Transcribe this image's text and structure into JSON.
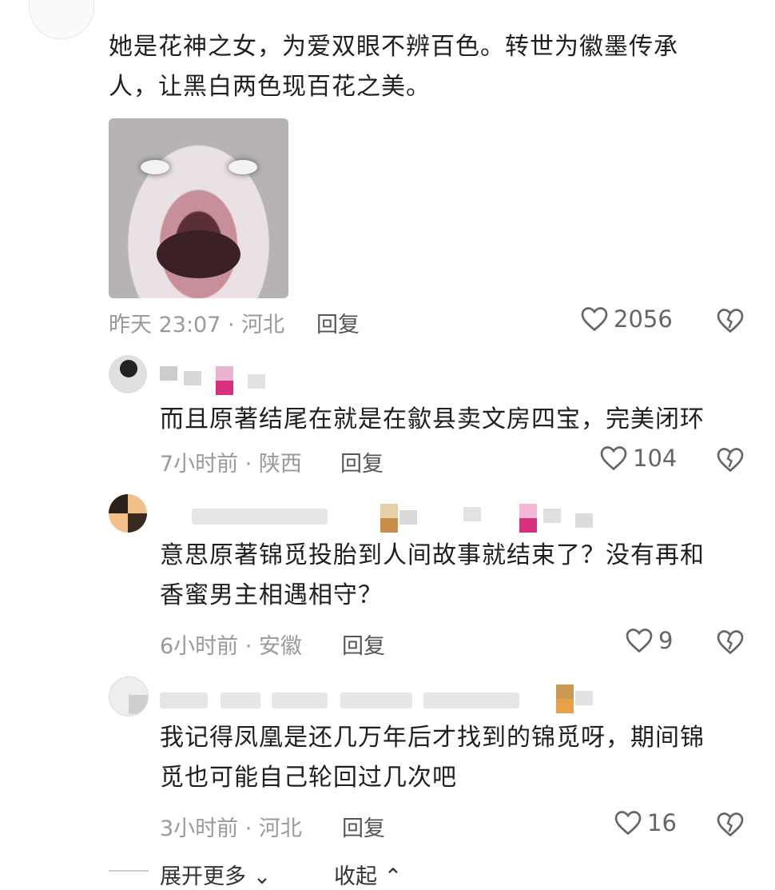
{
  "top_comment": {
    "text_line1": "她是花神之女，为爱双眼不辨百色。转世为徽墨传承",
    "text_line2": "人，让黑白两色现百花之美。",
    "meta": "昨天 23:07 · 河北",
    "reply_label": "回复",
    "likes": "2056"
  },
  "replies": [
    {
      "text_lines": [
        "而且原著结尾在就是在歙县卖文房四宝，完美闭环"
      ],
      "meta": "7小时前 · 陕西",
      "reply_label": "回复",
      "likes": "104"
    },
    {
      "text_lines": [
        "意思原著锦觅投胎到人间故事就结束了？没有再和",
        "香蜜男主相遇相守？"
      ],
      "meta": "6小时前 · 安徽",
      "reply_label": "回复",
      "likes": "9"
    },
    {
      "text_lines": [
        "我记得凤凰是还几万年后才找到的锦觅呀，期间锦",
        "觅也可能自己轮回过几次吧"
      ],
      "meta": "3小时前 · 河北",
      "reply_label": "回复",
      "likes": "16"
    }
  ],
  "footer": {
    "expand_label": "展开更多",
    "collapse_label": "收起"
  },
  "icons": {
    "like": "heart-outline-icon",
    "dislike": "broken-heart-icon"
  }
}
